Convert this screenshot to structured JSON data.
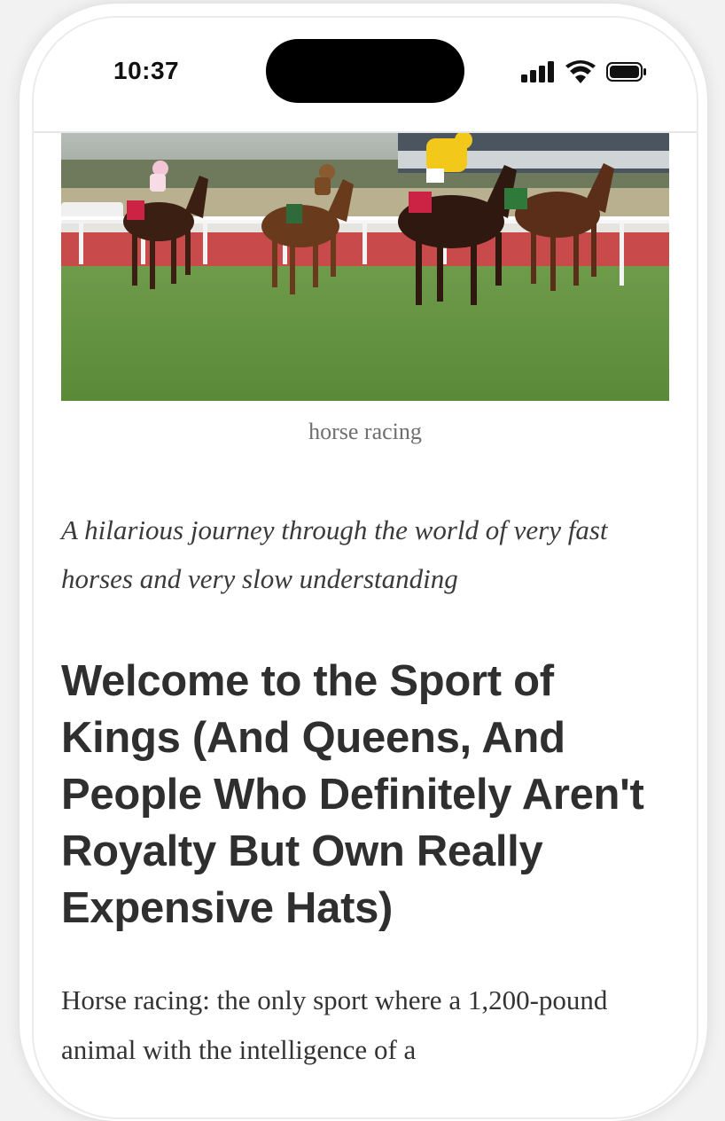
{
  "status_bar": {
    "time": "10:37",
    "icons": [
      "cellular-signal-icon",
      "wifi-icon",
      "battery-icon"
    ]
  },
  "article": {
    "hero_image_alt": "horse racing",
    "caption": "horse racing",
    "subtitle": "A hilarious journey through the world of very fast horses and very slow understanding",
    "headline": "Welcome to the Sport of Kings (And Queens, And People Who Definitely Aren't Royalty But Own Really Expensive Hats)",
    "body_start": "Horse racing: the only sport where a 1,200-pound animal with the intelligence of a"
  },
  "colors": {
    "grass": "#5d8b3e",
    "rail": "#c94a4a",
    "text": "#2f2f2f",
    "caption": "#6f6f6f"
  }
}
